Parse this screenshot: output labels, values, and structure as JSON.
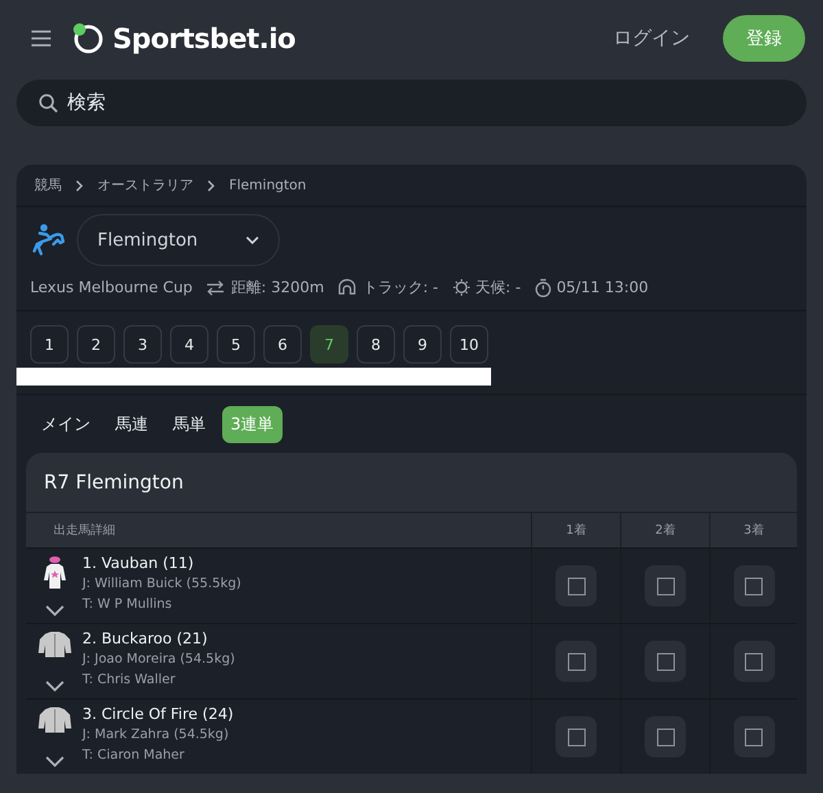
{
  "header": {
    "logo": "Sportsbet.io",
    "login": "ログイン",
    "register": "登録"
  },
  "search": {
    "placeholder": "検索"
  },
  "breadcrumb": [
    "競馬",
    "オーストラリア",
    "Flemington"
  ],
  "venue": {
    "selected_value": "Flemington"
  },
  "race_info": {
    "name": "Lexus Melbourne Cup",
    "distance": "距離: 3200m",
    "track": "トラック: -",
    "weather": "天候: -",
    "time": "05/11 13:00"
  },
  "races": [
    {
      "label": "1",
      "selected": false
    },
    {
      "label": "2",
      "selected": false
    },
    {
      "label": "3",
      "selected": false
    },
    {
      "label": "4",
      "selected": false
    },
    {
      "label": "5",
      "selected": false
    },
    {
      "label": "6",
      "selected": false
    },
    {
      "label": "7",
      "selected": true
    },
    {
      "label": "8",
      "selected": false
    },
    {
      "label": "9",
      "selected": false
    },
    {
      "label": "10",
      "selected": false
    }
  ],
  "tabs": [
    {
      "label": "メイン",
      "selected": false
    },
    {
      "label": "馬連",
      "selected": false
    },
    {
      "label": "馬単",
      "selected": false
    },
    {
      "label": "3連単",
      "selected": true
    }
  ],
  "table": {
    "title": "R7 Flemington",
    "columns": [
      "出走馬詳細",
      "1着",
      "2着",
      "3着"
    ],
    "rows": [
      {
        "name": "1. Vauban (11)",
        "jockey": "J: William Buick (55.5kg)",
        "trainer": "T: W P Mullins",
        "kind": "pink-silk",
        "picks": [
          {
            "checked": false
          },
          {
            "checked": false
          },
          {
            "checked": false
          }
        ]
      },
      {
        "name": "2. Buckaroo (21)",
        "jockey": "J: Joao Moreira (54.5kg)",
        "trainer": "T: Chris Waller",
        "kind": "plain-silk",
        "picks": [
          {
            "checked": false
          },
          {
            "checked": false
          },
          {
            "checked": false
          }
        ]
      },
      {
        "name": "3. Circle Of Fire (24)",
        "jockey": "J: Mark Zahra (54.5kg)",
        "trainer": "T: Ciaron Maher",
        "kind": "plain-silk",
        "picks": [
          {
            "checked": false
          },
          {
            "checked": false
          },
          {
            "checked": false
          }
        ]
      }
    ]
  }
}
